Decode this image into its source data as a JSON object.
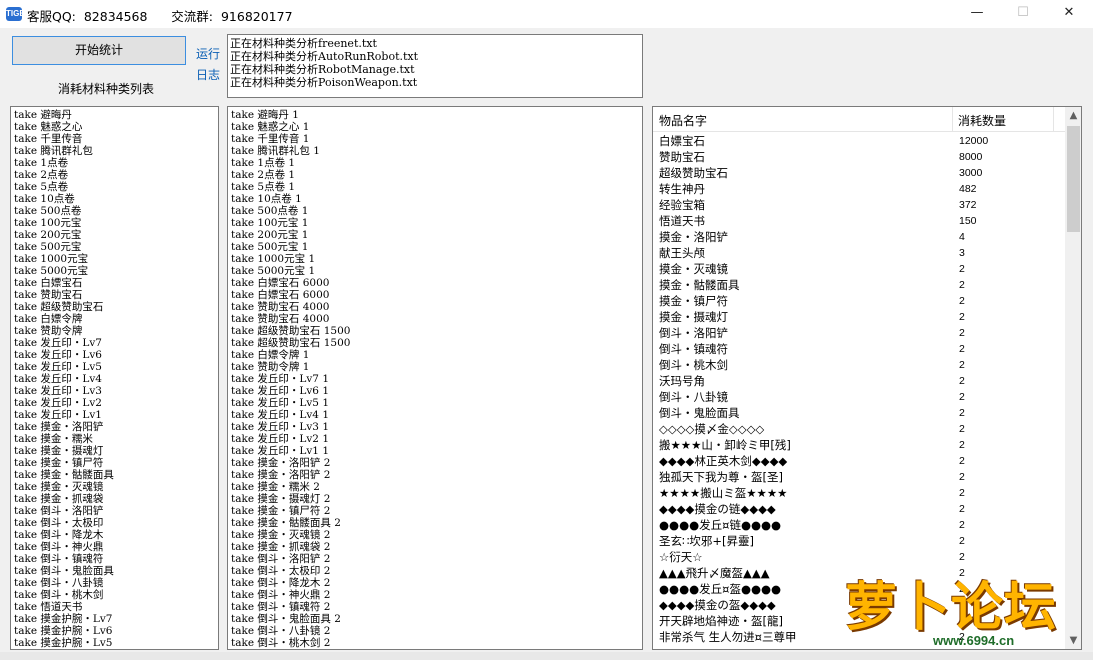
{
  "window": {
    "title": "客服QQ:  82834568      交流群:  916820177",
    "logo_text": "TIGER",
    "minimize": "—",
    "maximize": "☐",
    "close": "✕"
  },
  "controls": {
    "start_button": "开始统计",
    "list_label": "消耗材料种类列表",
    "run_link": "运行",
    "log_link": "日志"
  },
  "log": [
    "正在材料种类分析freenet.txt",
    "正在材料种类分析AutoRunRobot.txt",
    "正在材料种类分析RobotManage.txt",
    "正在材料种类分析PoisonWeapon.txt"
  ],
  "pane_a": [
    "take 避晦丹",
    "take 魅惑之心",
    "take 千里传音",
    "take 腾讯群礼包",
    "take 1点卷",
    "take 2点卷",
    "take 5点卷",
    "take 10点卷",
    "take 500点卷",
    "take 100元宝",
    "take 200元宝",
    "take 500元宝",
    "take 1000元宝",
    "take 5000元宝",
    "take 白嫖宝石",
    "take 赞助宝石",
    "take 超级赞助宝石",
    "take 白嫖令牌",
    "take 赞助令牌",
    "take 发丘印・Lv7",
    "take 发丘印・Lv6",
    "take 发丘印・Lv5",
    "take 发丘印・Lv4",
    "take 发丘印・Lv3",
    "take 发丘印・Lv2",
    "take 发丘印・Lv1",
    "take 摸金・洛阳铲",
    "take 摸金・糯米",
    "take 摸金・摄魂灯",
    "take 摸金・镇尸符",
    "take 摸金・骷髅面具",
    "take 摸金・灭魂镜",
    "take 摸金・抓魂袋",
    "take 倒斗・洛阳铲",
    "take 倒斗・太极印",
    "take 倒斗・降龙木",
    "take 倒斗・神火鼎",
    "take 倒斗・镇魂符",
    "take 倒斗・鬼脸面具",
    "take 倒斗・八卦镜",
    "take 倒斗・桃木剑",
    "take 悟道天书",
    "take 摸金护腕・Lv7",
    "take 摸金护腕・Lv6",
    "take 摸金护腕・Lv5"
  ],
  "pane_b": [
    "take 避晦丹 1",
    "take 魅惑之心 1",
    "take 千里传音 1",
    "take 腾讯群礼包 1",
    "take 1点卷 1",
    "take 2点卷 1",
    "take 5点卷 1",
    "take 10点卷 1",
    "take 500点卷 1",
    "take 100元宝 1",
    "take 200元宝 1",
    "take 500元宝 1",
    "take 1000元宝 1",
    "take 5000元宝 1",
    "take 白嫖宝石 6000",
    "take 白嫖宝石 6000",
    "take 赞助宝石 4000",
    "take 赞助宝石 4000",
    "take 超级赞助宝石 1500",
    "take 超级赞助宝石 1500",
    "take 白嫖令牌 1",
    "take 赞助令牌 1",
    "take 发丘印・Lv7 1",
    "take 发丘印・Lv6 1",
    "take 发丘印・Lv5 1",
    "take 发丘印・Lv4 1",
    "take 发丘印・Lv3 1",
    "take 发丘印・Lv2 1",
    "take 发丘印・Lv1 1",
    "take 摸金・洛阳铲 2",
    "take 摸金・洛阳铲 2",
    "take 摸金・糯米 2",
    "take 摸金・摄魂灯 2",
    "take 摸金・镇尸符 2",
    "take 摸金・骷髅面具 2",
    "take 摸金・灭魂镜 2",
    "take 摸金・抓魂袋 2",
    "take 倒斗・洛阳铲 2",
    "take 倒斗・太极印 2",
    "take 倒斗・降龙木 2",
    "take 倒斗・神火鼎 2",
    "take 倒斗・镇魂符 2",
    "take 倒斗・鬼脸面具 2",
    "take 倒斗・八卦镜 2",
    "take 倒斗・桃木剑 2"
  ],
  "listview": {
    "col_name": "物品名字",
    "col_qty": "消耗数量",
    "rows": [
      {
        "name": "白嫖宝石",
        "qty": "12000"
      },
      {
        "name": "赞助宝石",
        "qty": "8000"
      },
      {
        "name": "超级赞助宝石",
        "qty": "3000"
      },
      {
        "name": "转生神丹",
        "qty": "482"
      },
      {
        "name": "经验宝箱",
        "qty": "372"
      },
      {
        "name": "悟道天书",
        "qty": "150"
      },
      {
        "name": "摸金・洛阳铲",
        "qty": "4"
      },
      {
        "name": "献王头颅",
        "qty": "3"
      },
      {
        "name": "摸金・灭魂镜",
        "qty": "2"
      },
      {
        "name": "摸金・骷髅面具",
        "qty": "2"
      },
      {
        "name": "摸金・镇尸符",
        "qty": "2"
      },
      {
        "name": "摸金・摄魂灯",
        "qty": "2"
      },
      {
        "name": "倒斗・洛阳铲",
        "qty": "2"
      },
      {
        "name": "倒斗・镇魂符",
        "qty": "2"
      },
      {
        "name": "倒斗・桃木剑",
        "qty": "2"
      },
      {
        "name": "沃玛号角",
        "qty": "2"
      },
      {
        "name": "倒斗・八卦镜",
        "qty": "2"
      },
      {
        "name": "倒斗・鬼脸面具",
        "qty": "2"
      },
      {
        "name": "◇◇◇◇摸〆金◇◇◇◇",
        "qty": "2"
      },
      {
        "name": "搬★★★山・卸岭ミ甲[残]",
        "qty": "2"
      },
      {
        "name": "◆◆◆◆林正英木剑◆◆◆◆",
        "qty": "2"
      },
      {
        "name": "独孤天下我为尊・盔[圣]",
        "qty": "2"
      },
      {
        "name": "★★★★搬山ミ盔★★★★",
        "qty": "2"
      },
      {
        "name": "◆◆◆◆摸金の链◆◆◆◆",
        "qty": "2"
      },
      {
        "name": "●●●●发丘¤链●●●●",
        "qty": "2"
      },
      {
        "name": "圣玄∷坎邪+[昇靈]",
        "qty": "2"
      },
      {
        "name": "☆衍天☆",
        "qty": "2"
      },
      {
        "name": "▲▲▲飛升〆魔盔▲▲▲",
        "qty": "2"
      },
      {
        "name": "●●●●发丘¤盔●●●●",
        "qty": "2"
      },
      {
        "name": "◆◆◆◆摸金の盔◆◆◆◆",
        "qty": "2"
      },
      {
        "name": "开天辟地焰神迹・盔[龍]",
        "qty": "2"
      },
      {
        "name": "非常杀气 生人勿进¤三尊甲",
        "qty": "2"
      }
    ]
  },
  "watermark": {
    "text": "萝卜论坛",
    "url": "www.6994.cn"
  }
}
